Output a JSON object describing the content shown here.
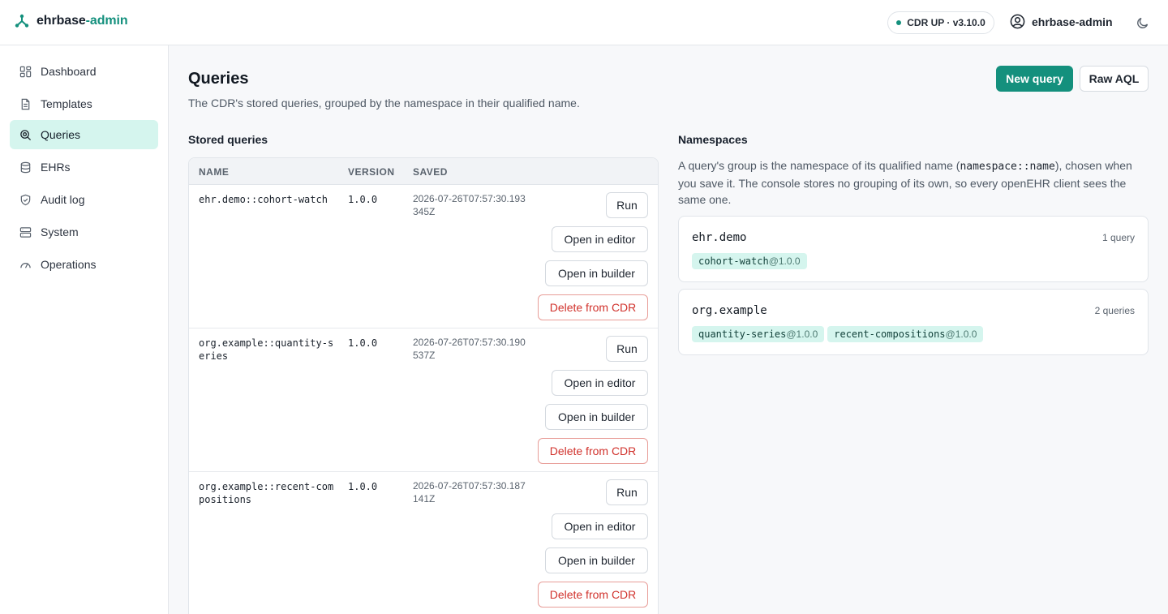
{
  "brand": {
    "name": "ehrbase",
    "accent": "-admin"
  },
  "header": {
    "status": "CDR UP · v3.10.0",
    "user": "ehrbase-admin"
  },
  "nav": {
    "dashboard": "Dashboard",
    "templates": "Templates",
    "queries": "Queries",
    "ehrs": "EHRs",
    "audit": "Audit log",
    "system": "System",
    "operations": "Operations"
  },
  "page": {
    "title": "Queries",
    "subtitle": "The CDR's stored queries, grouped by the namespace in their qualified name.",
    "new_query": "New query",
    "raw_aql": "Raw AQL"
  },
  "stored": {
    "title": "Stored queries",
    "columns": {
      "name": "NAME",
      "version": "VERSION",
      "saved": "SAVED"
    },
    "actions": {
      "run": "Run",
      "open_editor": "Open in editor",
      "open_builder": "Open in builder",
      "delete": "Delete from CDR"
    },
    "rows": [
      {
        "name": "ehr.demo::cohort-watch",
        "version": "1.0.0",
        "saved": "2026-07-26T07:57:30.193345Z"
      },
      {
        "name": "org.example::quantity-series",
        "version": "1.0.0",
        "saved": "2026-07-26T07:57:30.190537Z"
      },
      {
        "name": "org.example::recent-compositions",
        "version": "1.0.0",
        "saved": "2026-07-26T07:57:30.187141Z"
      }
    ]
  },
  "namespaces": {
    "title": "Namespaces",
    "desc_1": "A query's group is the namespace of its qualified name (",
    "desc_code": "namespace::name",
    "desc_2": "), chosen when you save it. The console stores no grouping of its own, so every openEHR client sees the same one.",
    "groups": [
      {
        "name": "ehr.demo",
        "count": "1 query",
        "chips": [
          {
            "name": "cohort-watch",
            "version": "@1.0.0"
          }
        ]
      },
      {
        "name": "org.example",
        "count": "2 queries",
        "chips": [
          {
            "name": "quantity-series",
            "version": "@1.0.0"
          },
          {
            "name": "recent-compositions",
            "version": "@1.0.0"
          }
        ]
      }
    ]
  }
}
